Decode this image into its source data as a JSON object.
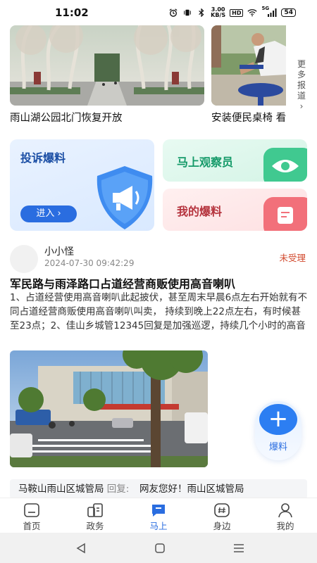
{
  "status_bar": {
    "time": "11:02",
    "network_speed_value": "3.00",
    "network_speed_unit": "KB/S",
    "hd_label": "HD",
    "signal_label": "5G",
    "battery": "54"
  },
  "news": {
    "items": [
      {
        "title": "雨山湖公园北门恢复开放"
      },
      {
        "title": "安装便民桌椅 看"
      }
    ],
    "more_label": "更多报道",
    "more_arrow": "›"
  },
  "actions": {
    "complaint": {
      "title": "投诉爆料",
      "button": "进入 ›"
    },
    "observer": {
      "title": "马上观察员"
    },
    "my_reports": {
      "title": "我的爆料"
    }
  },
  "post": {
    "author": "小小怪",
    "time": "2024-07-30 09:42:29",
    "status": "未受理",
    "title": "军民路与雨泽路口占道经营商贩使用高音喇叭",
    "body": "1、占道经营使用高音喇叭此起披伏，甚至周末早晨6点左右开始就有不同占道经营商贩使用高音喇叭叫卖， 持续到晚上22点左右，有时候甚至23点；2、佳山乡城管12345回复是加强巡逻，持续几个小时的高音喇叭，巡..."
  },
  "reply": {
    "agency": "马鞍山雨山区城管局",
    "label": "回复:",
    "text": "网友您好！雨山区城管局"
  },
  "fab": {
    "icon": "+",
    "label": "爆料"
  },
  "tabs": [
    {
      "label": "首页",
      "icon": "home-icon",
      "active": false
    },
    {
      "label": "政务",
      "icon": "government-icon",
      "active": false
    },
    {
      "label": "马上",
      "icon": "report-icon",
      "active": true
    },
    {
      "label": "身边",
      "icon": "nearby-icon",
      "active": false
    },
    {
      "label": "我的",
      "icon": "user-icon",
      "active": false
    }
  ],
  "colors": {
    "accent": "#2a6de0",
    "status_pending": "#d24a2e",
    "complaint_bg": "#e4efff",
    "observer_bg": "#dff7ec",
    "my_reports_bg": "#fde6e8"
  }
}
